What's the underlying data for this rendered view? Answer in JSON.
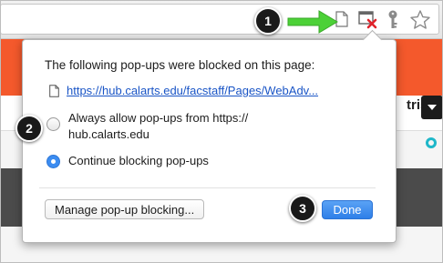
{
  "popup": {
    "heading": "The following pop-ups were blocked on this page:",
    "blocked_url": "https://hub.calarts.edu/facstaff/Pages/WebAdv...",
    "options": [
      {
        "label": "Always allow pop-ups from https:// hub.calarts.edu",
        "selected": false
      },
      {
        "label": "Continue blocking pop-ups",
        "selected": true
      }
    ],
    "manage_button": "Manage pop-up blocking...",
    "done_button": "Done"
  },
  "markers": [
    "1",
    "2",
    "3"
  ],
  "page_background": {
    "partial_text": "triss"
  },
  "toolbar_icons": [
    "file-icon",
    "popup-blocked-icon",
    "key-icon",
    "star-icon"
  ],
  "colors": {
    "arrow": "#4cd137",
    "accent_orange": "#f4592c",
    "done_blue": "#2e7fe8",
    "link_blue": "#1a55c6",
    "blocked_red": "#e0232b"
  }
}
